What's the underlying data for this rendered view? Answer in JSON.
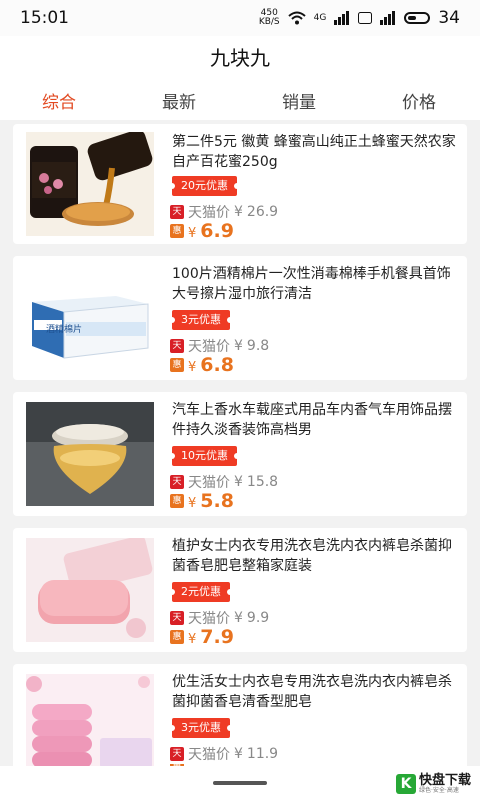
{
  "status": {
    "time": "15:01",
    "speed_top": "450",
    "speed_bottom": "KB/S",
    "battery": "34",
    "net": "4G"
  },
  "header": {
    "title": "九块九"
  },
  "tabs": [
    {
      "label": "综合",
      "active": true
    },
    {
      "label": "最新",
      "active": false
    },
    {
      "label": "销量",
      "active": false
    },
    {
      "label": "价格",
      "active": false
    }
  ],
  "products": [
    {
      "title": "第二件5元 徽黄 蜂蜜高山纯正土蜂蜜天然农家自产百花蜜250g",
      "coupon": "20元优惠",
      "platform": "天猫价",
      "orig_price": "26.9",
      "price": "6.9",
      "image": "honey-jar-icon"
    },
    {
      "title": "100片酒精棉片一次性消毒棉棒手机餐具首饰大号擦片湿巾旅行清洁",
      "coupon": "3元优惠",
      "platform": "天猫价",
      "orig_price": "9.8",
      "price": "6.8",
      "image": "alcohol-pad-box-icon",
      "box_label": "酒精棉片"
    },
    {
      "title": "汽车上香水车载座式用品车内香气车用饰品摆件持久淡香装饰高档男",
      "coupon": "10元优惠",
      "platform": "天猫价",
      "orig_price": "15.8",
      "price": "5.8",
      "image": "car-perfume-icon"
    },
    {
      "title": "植护女士内衣专用洗衣皂洗内衣内裤皂杀菌抑菌香皂肥皂整箱家庭装",
      "coupon": "2元优惠",
      "platform": "天猫价",
      "orig_price": "9.9",
      "price": "7.9",
      "image": "pink-soap-icon"
    },
    {
      "title": "优生活女士内衣皂专用洗衣皂洗内衣内裤皂杀菌抑菌香皂清香型肥皂",
      "coupon": "3元优惠",
      "platform": "天猫价",
      "orig_price": "11.9",
      "price": "",
      "image": "soap-stack-icon"
    }
  ],
  "currency": "¥",
  "badges": {
    "tmall": "天",
    "hui": "惠"
  },
  "watermark": {
    "logo": "K",
    "name": "快盘下载",
    "sub": "绿色·安全·高速"
  }
}
